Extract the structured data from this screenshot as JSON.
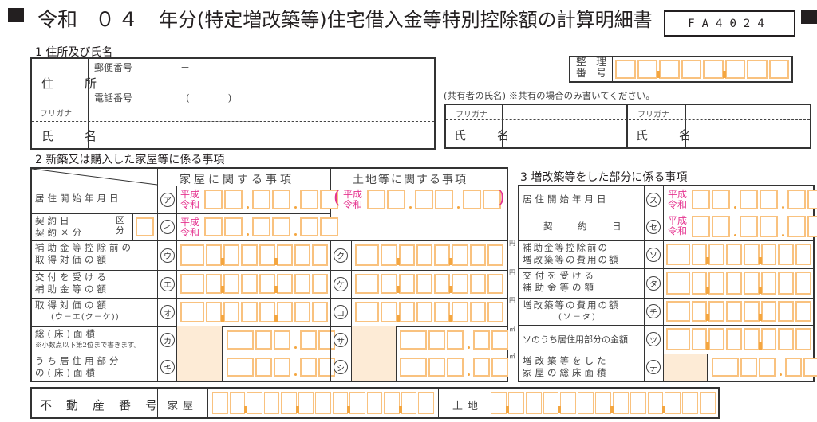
{
  "header": {
    "era": "令和",
    "year": "０４",
    "title_rest": "年分(特定増改築等)住宅借入金等特別控除額の計算明細書",
    "form_code": "FA4024"
  },
  "section1": {
    "heading": "1  住所及び氏名",
    "address_label": "住　所",
    "postal_label": "郵便番号",
    "postal_sep": "－",
    "phone_label": "電話番号",
    "phone_parens": "(　　　　)",
    "furigana_label": "フリガナ",
    "name_label": "氏　名",
    "seiri_label_1": "整 理",
    "seiri_label_2": "番 号",
    "co_owner_note": "(共有者の氏名) ※共有の場合のみ書いてください。",
    "co_owner_furigana": "フリガナ",
    "co_owner_name_label": "氏　名"
  },
  "section2": {
    "heading": "2  新築又は購入した家屋等に係る事項",
    "col_house": "家屋に関する事項",
    "col_land": "土地等に関する事項",
    "era_top": "平成",
    "era_bottom": "令和",
    "rows": [
      {
        "label1": "居住開始年月日",
        "label2": "",
        "mark_house": "ア",
        "mark_land": ""
      },
      {
        "label1": "契約日",
        "label2": "契約区分",
        "kubun": "区分",
        "mark_house": "イ",
        "mark_land": ""
      },
      {
        "label1": "補助金等控除前の",
        "label2": "取得対価の額",
        "mark_house": "ウ",
        "mark_land": "ク",
        "unit": "円"
      },
      {
        "label1": "交付を受ける",
        "label2": "補助金等の額",
        "mark_house": "エ",
        "mark_land": "ケ",
        "unit": "円"
      },
      {
        "label1": "取得対価の額",
        "label2": "(ウ－エ(ク－ケ))",
        "mark_house": "オ",
        "mark_land": "コ",
        "unit": "円"
      },
      {
        "label1": "総(床)面積",
        "label2": "※小数点以下第2位まで書きます。",
        "mark_house": "カ",
        "mark_land": "サ",
        "unit": "㎡"
      },
      {
        "label1": "うち居住用部分",
        "label2": "の(床)面積",
        "mark_house": "キ",
        "mark_land": "シ",
        "unit": "㎡"
      }
    ]
  },
  "section3": {
    "heading": "3  増改築等をした部分に係る事項",
    "rows": [
      {
        "label1": "居住開始年月日",
        "label2": "",
        "mark": "ス"
      },
      {
        "label1": "契　約　日",
        "label2": "",
        "mark": "セ"
      },
      {
        "label1": "補助金等控除前の",
        "label2": "増改築等の費用の額",
        "mark": "ソ"
      },
      {
        "label1": "交付を受ける",
        "label2": "補助金等の額",
        "mark": "タ"
      },
      {
        "label1": "増改築等の費用の額",
        "label2": "(ソ－タ)",
        "mark": "チ"
      },
      {
        "label1": "ソのうち居住用部分の金額",
        "label2": "",
        "mark": "ツ"
      },
      {
        "label1": "増改築等をした",
        "label2": "家屋の総床面積",
        "mark": "テ"
      }
    ]
  },
  "real_estate": {
    "label": "不動産番号",
    "house_label": "家屋",
    "land_label": "土地",
    "digits": 13
  }
}
